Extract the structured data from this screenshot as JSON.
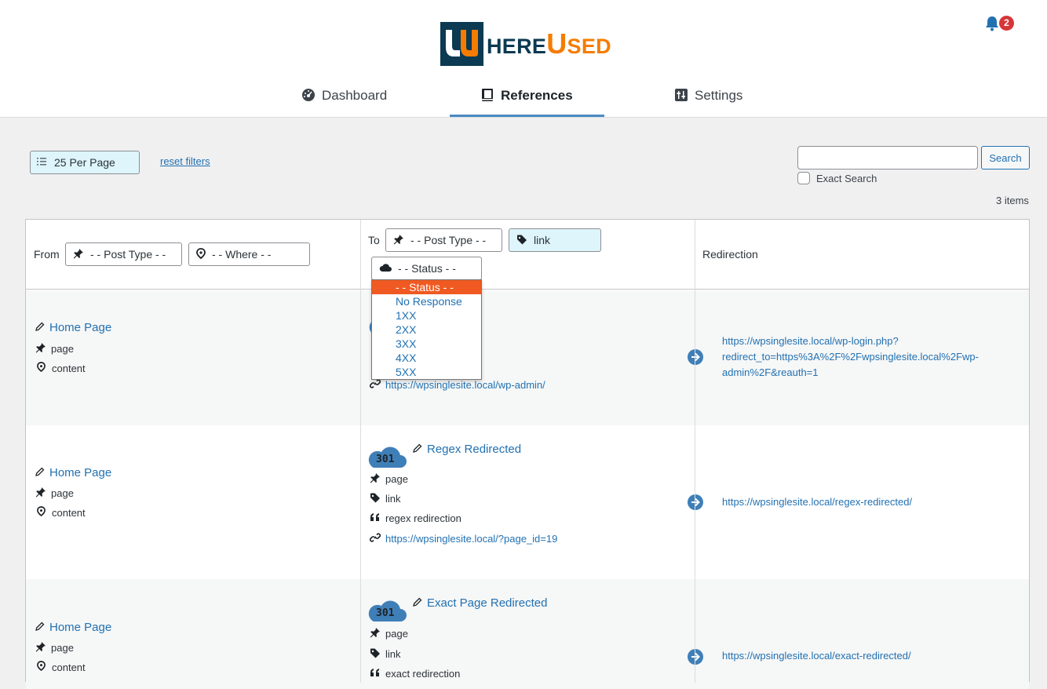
{
  "header": {
    "logo_text_a": "HERE",
    "logo_text_b": "U",
    "logo_text_c": "SED",
    "notification_count": "2"
  },
  "tabs": [
    {
      "label": "Dashboard",
      "icon": "dashboard-icon"
    },
    {
      "label": "References",
      "icon": "book-icon",
      "active": true
    },
    {
      "label": "Settings",
      "icon": "settings-icon"
    }
  ],
  "filters": {
    "per_page": "25 Per Page",
    "reset": "reset filters",
    "search_value": "",
    "search_button": "Search",
    "exact_search": "Exact Search",
    "items_count": "3 items"
  },
  "columns": {
    "from": "From",
    "from_post_type": "- - Post Type - -",
    "from_where": "- - Where - -",
    "to": "To",
    "to_post_type": "- - Post Type - -",
    "to_link": "link",
    "to_status": "- - Status - -",
    "redirection": "Redirection"
  },
  "status_dropdown": {
    "options": [
      "- - Status - -",
      "No Response",
      "1XX",
      "2XX",
      "3XX",
      "4XX",
      "5XX"
    ],
    "selected_index": 0
  },
  "rows": [
    {
      "from_title": "Home Page",
      "from_type": "page",
      "from_where": "content",
      "to_url": "https://wpsinglesite.local/wp-admin/",
      "redirect_line1": "https://wpsinglesite.local/wp-login.php?",
      "redirect_line2": "redirect_to=https%3A%2F%2Fwpsinglesite.local%2Fwp-",
      "redirect_line3": "admin%2F&reauth=1"
    },
    {
      "from_title": "Home Page",
      "from_type": "page",
      "from_where": "content",
      "status_code": "301",
      "to_title": "Regex Redirected",
      "to_type": "page",
      "to_link": "link",
      "to_note": "regex redirection",
      "to_url": "https://wpsinglesite.local/?page_id=19",
      "redirect_line1": "https://wpsinglesite.local/regex-redirected/"
    },
    {
      "from_title": "Home Page",
      "from_type": "page",
      "from_where": "content",
      "status_code": "301",
      "to_title": "Exact Page Redirected",
      "to_type": "page",
      "to_link": "link",
      "to_note": "exact redirection",
      "redirect_line1": "https://wpsinglesite.local/exact-redirected/"
    }
  ],
  "colors": {
    "accent": "#2271b1",
    "cloud": "#3f7fb8",
    "dropdown_selected": "#f05a22",
    "logo_dark": "#0b3a52",
    "logo_orange": "#f57c00"
  }
}
